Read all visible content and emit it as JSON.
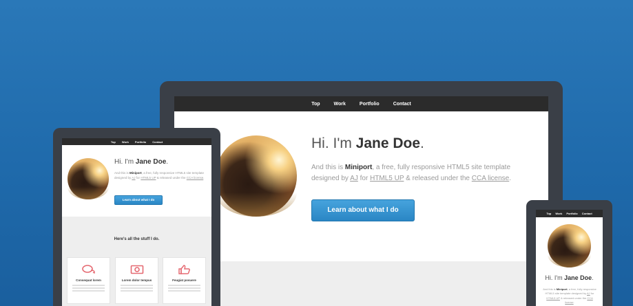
{
  "nav": {
    "items": [
      "Top",
      "Work",
      "Portfolio",
      "Contact"
    ]
  },
  "hero": {
    "greeting": "Hi. I'm ",
    "name": "Jane Doe",
    "period": ".",
    "intro_prefix": "And this is ",
    "site_name": "Miniport",
    "intro_mid": ", a free, fully responsive HTML5 site template designed by ",
    "designer": "AJ",
    "intro_for": " for ",
    "publisher": "HTML5 UP",
    "intro_end": " & released under the ",
    "license": "CCA license",
    "button": "Learn about what I do"
  },
  "section": {
    "title": "Here's all the stuff I do."
  },
  "cards": [
    {
      "icon": "chat-bubbles-icon",
      "title": "Consequat lorem"
    },
    {
      "icon": "camera-icon",
      "title": "Lorem dolor tempus"
    },
    {
      "icon": "thumbs-up-icon",
      "title": "Feugiat posuere"
    }
  ],
  "colors": {
    "background": "#1f6aab",
    "device_frame": "#3a3f47",
    "nav_bar": "#2b2b2b",
    "button": "#2a86c4",
    "card_icon": "#e56a72"
  }
}
